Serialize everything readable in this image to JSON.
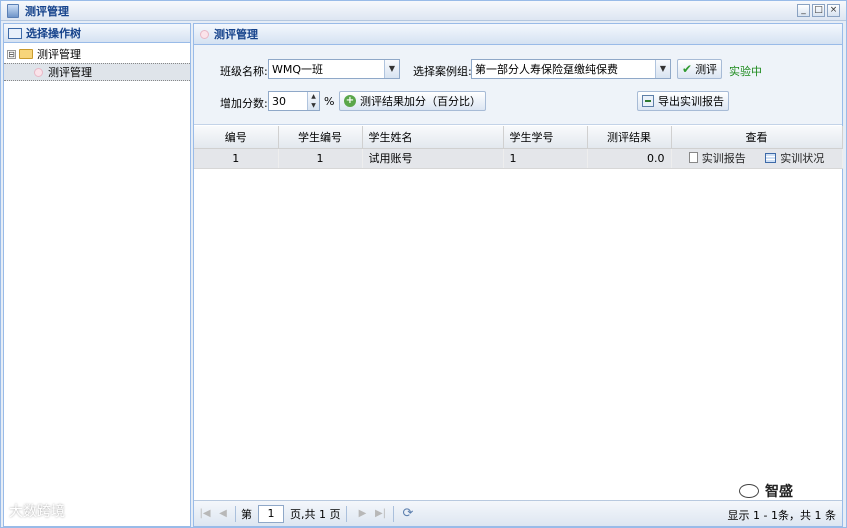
{
  "window": {
    "title": "测评管理",
    "controls": [
      "_",
      "□",
      "×"
    ]
  },
  "left_panel": {
    "header": "选择操作树",
    "tree": {
      "parent_label": "测评管理",
      "expander": "⊟",
      "child_label": "测评管理"
    }
  },
  "main_panel": {
    "header": "测评管理",
    "form": {
      "class_label": "班级名称:",
      "class_value": "WMQ一班",
      "case_label": "选择案例组:",
      "case_value": "第一部分人寿保险趸缴纯保费",
      "evaluate_button": "测评",
      "status_text": "实验中",
      "add_score_label": "增加分数:",
      "add_score_value": "30",
      "percent_sign": "%",
      "add_percent_button": "测评结果加分（百分比）",
      "export_button": "导出实训报告"
    },
    "grid": {
      "columns": [
        "编号",
        "学生编号",
        "学生姓名",
        "学生学号",
        "测评结果",
        "查看"
      ],
      "rows": [
        {
          "id": "1",
          "student_no": "1",
          "student_name": "试用账号",
          "student_number": "1",
          "result": "0.0",
          "report_link": "实训报告",
          "status_link": "实训状况"
        }
      ]
    },
    "pager": {
      "page_prefix": "第",
      "page_value": "1",
      "page_suffix": "页,共 1 页",
      "info": "显示 1 - 1条，共 1 条"
    }
  },
  "watermarks": {
    "left": "大数跨境",
    "right": "智盛"
  }
}
